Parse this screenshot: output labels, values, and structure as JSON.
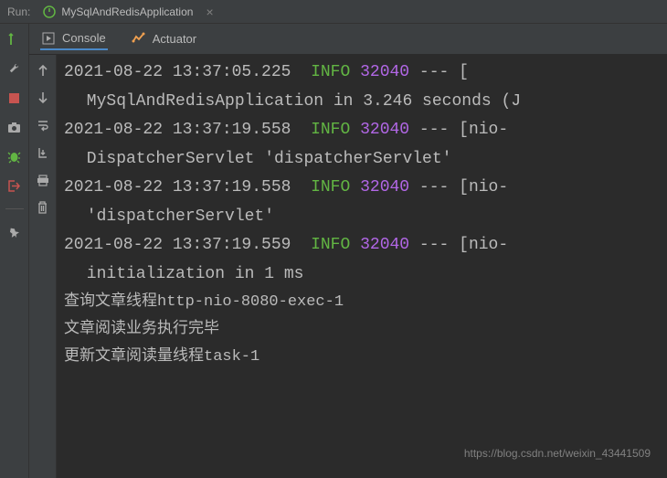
{
  "header": {
    "run_label": "Run:",
    "config_name": "MySqlAndRedisApplication"
  },
  "tabs": {
    "console": "Console",
    "actuator": "Actuator"
  },
  "log": {
    "lines": [
      {
        "ts": "2021-08-22 13:37:05.225",
        "level": "INFO",
        "pid": "32040",
        "dash": "---",
        "brack": "["
      },
      {
        "cont": " MySqlAndRedisApplication in 3.246 seconds (J"
      },
      {
        "ts": "2021-08-22 13:37:19.558",
        "level": "INFO",
        "pid": "32040",
        "dash": "---",
        "brack": "[nio-"
      },
      {
        "cont": " DispatcherServlet 'dispatcherServlet'"
      },
      {
        "ts": "2021-08-22 13:37:19.558",
        "level": "INFO",
        "pid": "32040",
        "dash": "---",
        "brack": "[nio-"
      },
      {
        "cont": " 'dispatcherServlet'"
      },
      {
        "ts": "2021-08-22 13:37:19.559",
        "level": "INFO",
        "pid": "32040",
        "dash": "---",
        "brack": "[nio-"
      },
      {
        "cont": " initialization in 1 ms"
      },
      {
        "plain": "查询文章线程http-nio-8080-exec-1"
      },
      {
        "plain": "文章阅读业务执行完毕"
      },
      {
        "plain": "更新文章阅读量线程task-1"
      }
    ]
  },
  "watermark": "https://blog.csdn.net/weixin_43441509"
}
